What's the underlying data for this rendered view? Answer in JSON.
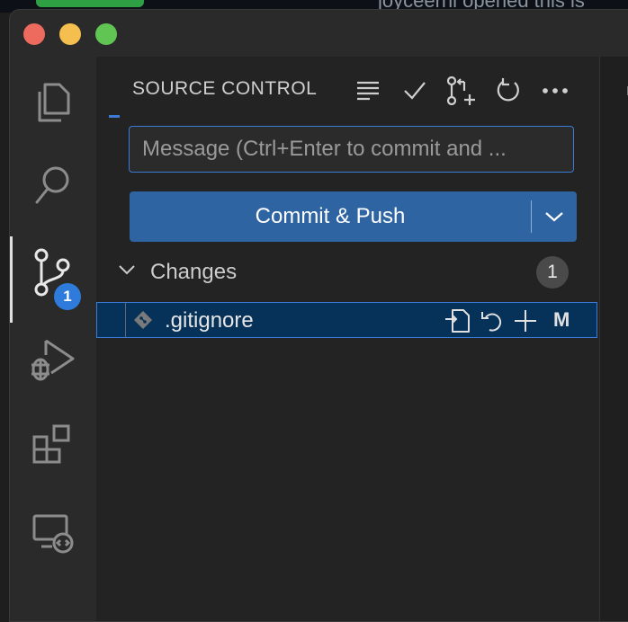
{
  "background": {
    "text": "joyceerhl opened this is"
  },
  "sidebar": {
    "title": "SOURCE CONTROL",
    "toolbar_icons": [
      "view-as-tree-icon",
      "commit-check-icon",
      "create-pull-request-icon",
      "refresh-icon",
      "more-actions-icon"
    ]
  },
  "commit": {
    "placeholder": "Message (Ctrl+Enter to commit and ...",
    "value": "",
    "button_label": "Commit & Push"
  },
  "activity_bar": {
    "items": [
      "explorer",
      "search",
      "source-control",
      "run-and-debug",
      "extensions",
      "remote-explorer"
    ],
    "source_control_badge": "1"
  },
  "changes": {
    "label": "Changes",
    "count": "1",
    "files": [
      {
        "name": ".gitignore",
        "status": "M"
      }
    ]
  },
  "colors": {
    "accent": "#3a7bd5",
    "button": "#2f64a3",
    "selection": "#06325a"
  }
}
